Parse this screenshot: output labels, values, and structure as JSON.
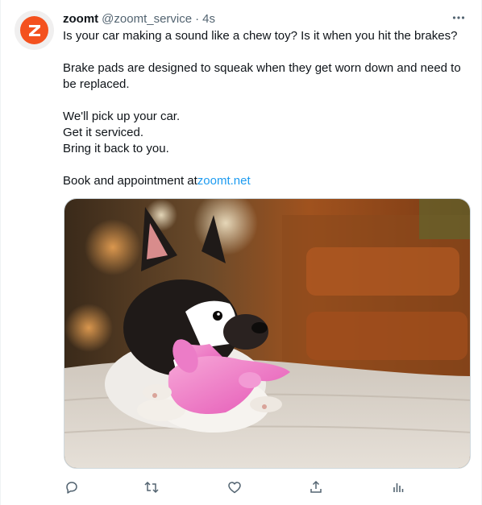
{
  "tweet": {
    "display_name": "zoomt",
    "handle": "@zoomt_service",
    "separator": "·",
    "timestamp": "4s",
    "avatar_letter": "Z",
    "lines": [
      "Is your car making a sound like a chew toy? Is it when you hit the brakes?",
      "Brake pads are designed to squeak when they get worn down and need to be replaced.",
      "We'll pick up your car.",
      "Get it serviced.",
      "Bring it back to you.",
      "Book and appointment at"
    ],
    "link_text": "zoomt.net",
    "image_alt": "Boston terrier puppy chewing a pink rubber toy"
  },
  "actions": [
    {
      "name": "reply",
      "icon": "reply-icon"
    },
    {
      "name": "retweet",
      "icon": "retweet-icon"
    },
    {
      "name": "like",
      "icon": "heart-icon"
    },
    {
      "name": "share",
      "icon": "share-icon"
    },
    {
      "name": "analytics",
      "icon": "analytics-icon"
    }
  ],
  "colors": {
    "brand": "#f4511e",
    "link": "#1d9bf0",
    "muted": "#536471",
    "text": "#0f1419"
  }
}
